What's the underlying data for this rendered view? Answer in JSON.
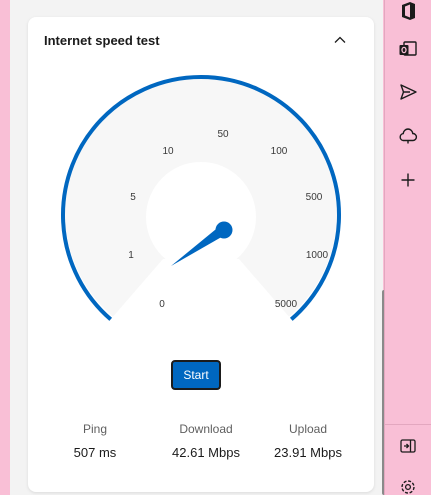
{
  "card": {
    "title": "Internet speed test",
    "collapse_icon": "chevron-up-icon"
  },
  "gauge": {
    "ticks": [
      "0",
      "1",
      "5",
      "10",
      "50",
      "100",
      "500",
      "1000",
      "5000"
    ],
    "needle_color": "#0067c0",
    "arc_color": "#0067c0"
  },
  "start_label": "Start",
  "stats": {
    "ping": {
      "label": "Ping",
      "value": "507 ms"
    },
    "download": {
      "label": "Download",
      "value": "42.61 Mbps"
    },
    "upload": {
      "label": "Upload",
      "value": "23.91 Mbps"
    }
  },
  "sidebar": {
    "icons": [
      "office-icon",
      "outlook-icon",
      "send-icon",
      "onedrive-icon",
      "add-icon",
      "sidebar-toggle-icon",
      "settings-icon"
    ]
  },
  "colors": {
    "accent": "#0067c0",
    "background": "#f9bfd6",
    "card": "#ffffff"
  }
}
